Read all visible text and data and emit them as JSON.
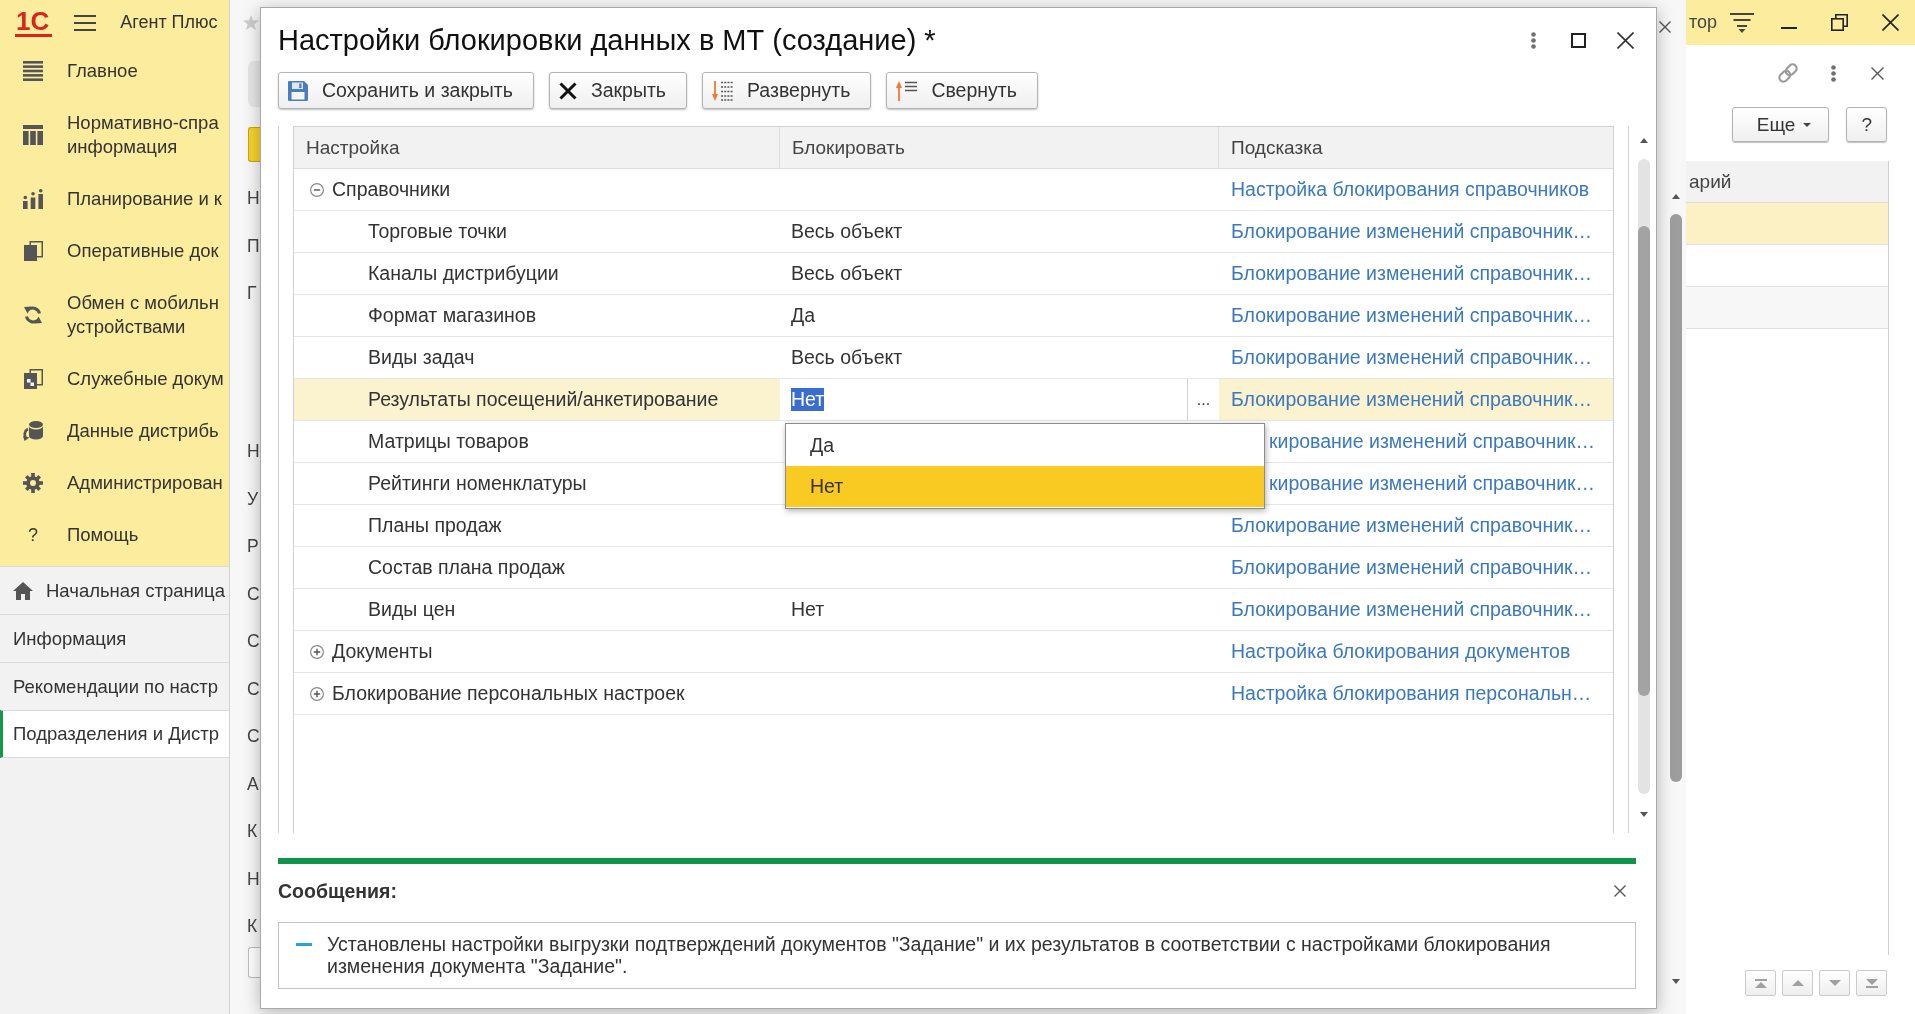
{
  "app_header": {
    "logo": "1С",
    "title": "Агент Плюс"
  },
  "sidebar": {
    "sections": [
      {
        "label": "Главное"
      },
      {
        "label": "Нормативно-спра\nинформация"
      },
      {
        "label": "Планирование и к"
      },
      {
        "label": "Оперативные док"
      },
      {
        "label": "Обмен с мобильн\nустройствами"
      },
      {
        "label": "Служебные докум"
      },
      {
        "label": "Данные дистрибь"
      },
      {
        "label": "Администрирован"
      },
      {
        "label": "Помощь",
        "glyph": "?"
      }
    ],
    "open_pages": [
      {
        "kind": "home",
        "label": "Начальная страница",
        "selected": false
      },
      {
        "kind": "page",
        "label": "Информация",
        "selected": false
      },
      {
        "kind": "page",
        "label": "Рекомендации по настр",
        "selected": false
      },
      {
        "kind": "page",
        "label": "Подразделения и Дистр",
        "selected": true
      }
    ]
  },
  "background_form": {
    "label_groups": [
      [
        "Н",
        "П",
        "Г"
      ],
      [
        "Н",
        "У",
        "Р",
        "С",
        "С",
        "С",
        "С",
        "А",
        "К",
        "Н",
        "К"
      ]
    ]
  },
  "right_panel": {
    "user": "тор",
    "buttons": [
      {
        "kind": "menu",
        "label": "Еще"
      },
      {
        "kind": "plain",
        "label": "?"
      }
    ],
    "table": {
      "columns": [
        "арий"
      ],
      "rows": [
        {
          "selected": true
        },
        {
          "selected": false
        },
        {
          "selected": false
        }
      ]
    }
  },
  "dialog": {
    "title": "Настройки блокировки данных в МТ (создание) *",
    "toolbar": [
      {
        "label": "Сохранить и закрыть"
      },
      {
        "label": "Закрыть"
      },
      {
        "label": "Развернуть"
      },
      {
        "label": "Свернуть"
      }
    ],
    "table": {
      "columns": [
        "Настройка",
        "Блокировать",
        "Подсказка"
      ],
      "rows": [
        {
          "setting": "Справочники",
          "hint": "Настройка блокирования справочников",
          "expanded": true,
          "selected": false,
          "children": [
            {
              "setting": "Торговые точки",
              "block": "Весь объект",
              "hint": "Блокирование изменений справочник…",
              "selected": false
            },
            {
              "setting": "Каналы дистрибуции",
              "block": "Весь объект",
              "hint": "Блокирование изменений справочник…",
              "selected": false
            },
            {
              "setting": "Формат магазинов",
              "block": "Да",
              "hint": "Блокирование изменений справочник…",
              "selected": false
            },
            {
              "setting": "Виды задач",
              "block": "Весь объект",
              "hint": "Блокирование изменений справочник…",
              "selected": false
            },
            {
              "setting": "Результаты посещений/анкетирование",
              "hint": "Блокирование изменений справочник…",
              "selected": true,
              "editor": {
                "value": "Нет",
                "choice_button": "...",
                "options": [
                  {
                    "label": "Да",
                    "selected": false
                  },
                  {
                    "label": "Нет",
                    "selected": true
                  }
                ]
              }
            },
            {
              "setting": "Матрицы товаров",
              "hint": "кирование изменений справочник…",
              "selected": false
            },
            {
              "setting": "Рейтинги номенклатуры",
              "hint": "кирование изменений справочник…",
              "selected": false
            },
            {
              "setting": "Планы продаж",
              "hint": "Блокирование изменений справочник…",
              "selected": false
            },
            {
              "setting": "Состав плана продаж",
              "hint": "Блокирование изменений справочник…",
              "selected": false
            },
            {
              "setting": "Виды цен",
              "block": "Нет",
              "hint": "Блокирование изменений справочник…",
              "selected": false
            }
          ]
        },
        {
          "setting": "Документы",
          "hint": "Настройка блокирования документов",
          "expanded": false,
          "selected": false
        },
        {
          "setting": "Блокирование персональных настроек",
          "hint": "Настройка блокирования персональн…",
          "expanded": false,
          "selected": false
        }
      ]
    },
    "messages": {
      "title": "Сообщения:",
      "items": [
        {
          "text": "Установлены настройки выгрузки подтверждений документов \"Задание\" и их результатов в соответствии с настройками блокирования изменения документа \"Задание\"."
        }
      ]
    }
  }
}
